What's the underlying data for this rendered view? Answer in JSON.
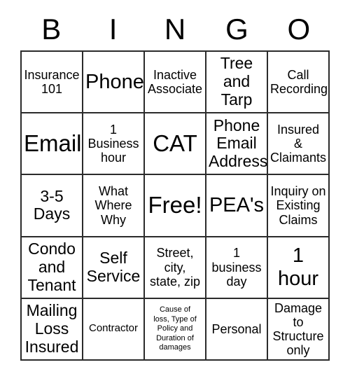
{
  "card": {
    "title": "BINGO",
    "header_letters": [
      "B",
      "I",
      "N",
      "G",
      "O"
    ],
    "grid_size": "5x5",
    "free_space": "Free!",
    "free_space_position": "row 3, column 3",
    "colors": {
      "background": "#ffffff",
      "border": "#2b2b2b",
      "text": "#000000"
    },
    "rows": [
      {
        "cells": [
          {
            "text": "Insurance\n101",
            "size": "sm"
          },
          {
            "text": "Phone",
            "size": "lg"
          },
          {
            "text": "Inactive\nAssociate",
            "size": "sm"
          },
          {
            "text": "Tree\nand\nTarp",
            "size": "md"
          },
          {
            "text": "Call\nRecording",
            "size": "sm"
          }
        ]
      },
      {
        "cells": [
          {
            "text": "Email",
            "size": "xl"
          },
          {
            "text": "1\nBusiness\nhour",
            "size": "sm"
          },
          {
            "text": "CAT",
            "size": "xl"
          },
          {
            "text": "Phone\nEmail\nAddress",
            "size": "md"
          },
          {
            "text": "Insured\n&\nClaimants",
            "size": "sm"
          }
        ]
      },
      {
        "cells": [
          {
            "text": "3-5\nDays",
            "size": "md"
          },
          {
            "text": "What\nWhere\nWhy",
            "size": "sm"
          },
          {
            "text": "Free!",
            "size": "xl"
          },
          {
            "text": "PEA's",
            "size": "lg"
          },
          {
            "text": "Inquiry on\nExisting\nClaims",
            "size": "sm"
          }
        ]
      },
      {
        "cells": [
          {
            "text": "Condo\nand\nTenant",
            "size": "md"
          },
          {
            "text": "Self\nService",
            "size": "md"
          },
          {
            "text": "Street,\ncity,\nstate, zip",
            "size": "sm"
          },
          {
            "text": "1\nbusiness\nday",
            "size": "sm"
          },
          {
            "text": "1\nhour",
            "size": "lg"
          }
        ]
      },
      {
        "cells": [
          {
            "text": "Mailing\nLoss\nInsured",
            "size": "md"
          },
          {
            "text": "Contractor",
            "size": "xs"
          },
          {
            "text": "Cause of\nloss, Type of\nPolicy and\nDuration of\ndamages",
            "size": "xxs"
          },
          {
            "text": "Personal",
            "size": "sm"
          },
          {
            "text": "Damage\nto\nStructure\nonly",
            "size": "sm"
          }
        ]
      }
    ]
  }
}
